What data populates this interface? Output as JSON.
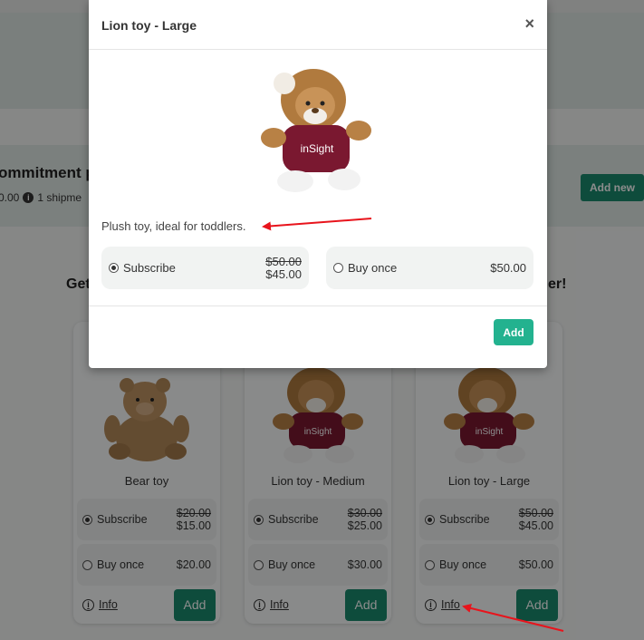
{
  "background": {
    "commitment_title": "ommitment p",
    "commitment_sub": "0.00",
    "commitment_shipments": "1 shipme",
    "add_new_label": "Add new",
    "section_left": "Get",
    "section_right": "er!"
  },
  "cards": [
    {
      "title": "Bear toy",
      "subscribe_label": "Subscribe",
      "orig_price": "$20.00",
      "sub_price": "$15.00",
      "once_label": "Buy once",
      "once_price": "$20.00",
      "info_label": "Info",
      "add_label": "Add"
    },
    {
      "title": "Lion toy - Medium",
      "subscribe_label": "Subscribe",
      "orig_price": "$30.00",
      "sub_price": "$25.00",
      "once_label": "Buy once",
      "once_price": "$30.00",
      "info_label": "Info",
      "add_label": "Add"
    },
    {
      "title": "Lion toy - Large",
      "subscribe_label": "Subscribe",
      "orig_price": "$50.00",
      "sub_price": "$45.00",
      "once_label": "Buy once",
      "once_price": "$50.00",
      "info_label": "Info",
      "add_label": "Add"
    }
  ],
  "modal": {
    "title": "Lion toy - Large",
    "close": "×",
    "description": "Plush toy, ideal for toddlers.",
    "subscribe_label": "Subscribe",
    "orig_price": "$50.00",
    "sub_price": "$45.00",
    "once_label": "Buy once",
    "once_price": "$50.00",
    "add_label": "Add",
    "shirt_text": "inSight"
  },
  "colors": {
    "accent": "#23b28f",
    "accent_dark": "#1a8a6e",
    "arrow": "#e8141c"
  }
}
